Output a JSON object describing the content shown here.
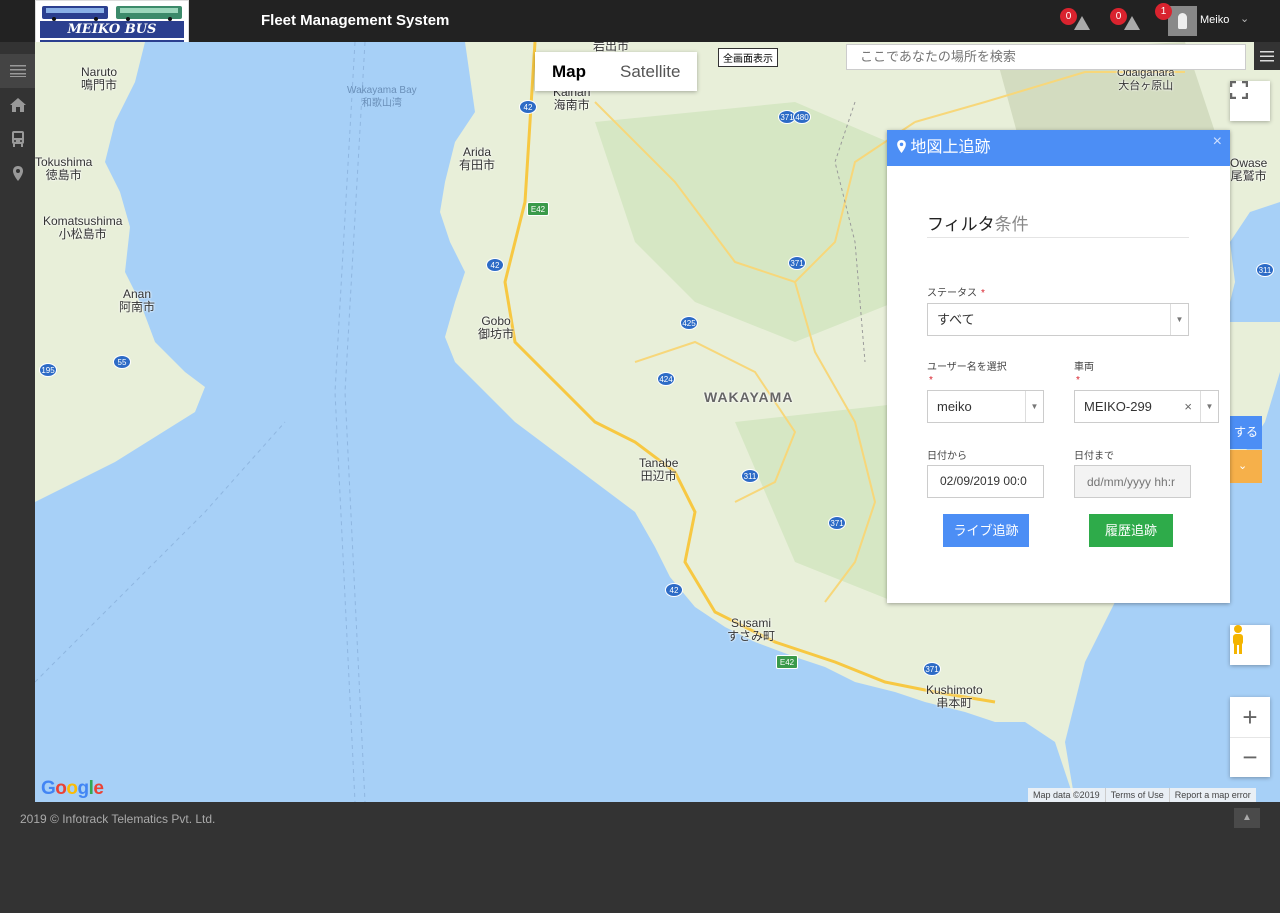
{
  "header": {
    "logo_text": "MEIKO BUS",
    "title": "Fleet Management System",
    "notifications": [
      {
        "count": "0",
        "icon": "alert-icon"
      },
      {
        "count": "0",
        "icon": "warning-icon"
      }
    ],
    "user": {
      "name": "Meiko",
      "badge": "1"
    }
  },
  "sidebar": {
    "items": [
      {
        "icon": "menu-icon"
      },
      {
        "icon": "home-icon"
      },
      {
        "icon": "bus-icon"
      },
      {
        "icon": "location-pin-icon"
      }
    ]
  },
  "map": {
    "type_map": "Map",
    "type_satellite": "Satellite",
    "fullscreen_label": "全画面表示",
    "search_placeholder": "ここであなたの場所を検索",
    "places": [
      {
        "en": "Naruto",
        "jp": "鳴門市"
      },
      {
        "en": "Tokushima",
        "jp": "徳島市"
      },
      {
        "en": "Komatsushima",
        "jp": "小松島市"
      },
      {
        "en": "Anan",
        "jp": "阿南市"
      },
      {
        "en": "Wakayama Bay",
        "jp": "和歌山湾"
      },
      {
        "en": "Arida",
        "jp": "有田市"
      },
      {
        "en": "Gobo",
        "jp": "御坊市"
      },
      {
        "en": "Tanabe",
        "jp": "田辺市"
      },
      {
        "en": "Susami",
        "jp": "すさみ町"
      },
      {
        "en": "Kushimoto",
        "jp": "串本町"
      },
      {
        "en": "Owase",
        "jp": "尾鷲市"
      },
      {
        "en": "Odaigahara",
        "jp": "大台ヶ原山"
      },
      {
        "en": "Kainan",
        "jp": "海南市"
      },
      {
        "en": "",
        "jp": "岩出市"
      }
    ],
    "region_label": "WAKAYAMA",
    "routes": [
      "42",
      "E42",
      "371",
      "480",
      "425",
      "424",
      "311",
      "195",
      "55",
      "311"
    ],
    "google_label": "Google",
    "attribution": [
      "Map data ©2019",
      "Terms of Use",
      "Report a map error"
    ],
    "side_tab_text": "する"
  },
  "panel": {
    "title": "地図上追跡",
    "filter_heading_main": "フィルタ",
    "filter_heading_sub": "条件",
    "status_label": "ステータス",
    "status_value": "すべて",
    "user_label": "ユーザー名を選択",
    "user_value": "meiko",
    "vehicle_label": "車両",
    "vehicle_value": "MEIKO-299",
    "date_from_label": "日付から",
    "date_from_value": "02/09/2019 00:0",
    "date_to_label": "日付まで",
    "date_to_placeholder": "dd/mm/yyyy hh:r",
    "live_button": "ライブ追跡",
    "history_button": "履歴追跡",
    "required_mark": "*",
    "close_mark": "×"
  },
  "footer": {
    "copyright": "2019 © Infotrack Telematics Pvt. Ltd."
  },
  "colors": {
    "accent": "#4c8ef5",
    "success": "#2eab4a",
    "badge": "#d9232e",
    "water": "#a7d0f7",
    "land": "#e8efd9"
  }
}
